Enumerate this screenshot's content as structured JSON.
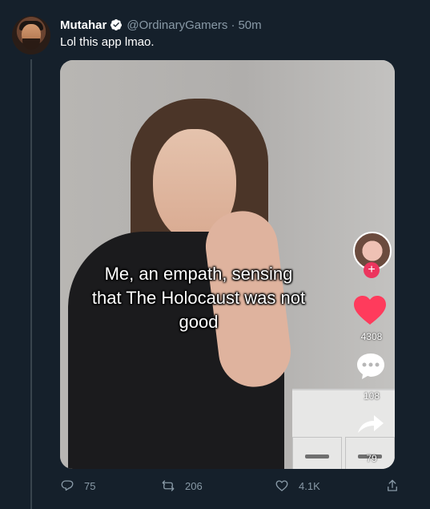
{
  "tweet": {
    "display_name": "Mutahar",
    "handle": "@OrdinaryGamers",
    "separator": "·",
    "time": "50m",
    "text": "Lol this app lmao."
  },
  "media": {
    "caption_line1": "Me, an empath, sensing",
    "caption_line2": "that The Holocaust was not",
    "caption_line3": "good",
    "like_count": "4308",
    "comment_count": "108",
    "share_count": "79"
  },
  "actions": {
    "reply_count": "75",
    "retweet_count": "206",
    "like_count": "4.1K"
  },
  "icons": {
    "verified": "verified-badge-icon",
    "reply": "reply-icon",
    "retweet": "retweet-icon",
    "like": "heart-icon",
    "share": "share-icon"
  },
  "colors": {
    "background": "#15202b",
    "text": "#ffffff",
    "muted": "#8899a6",
    "accent": "#1da1f2",
    "tiktok_like": "#ff3b5c"
  }
}
